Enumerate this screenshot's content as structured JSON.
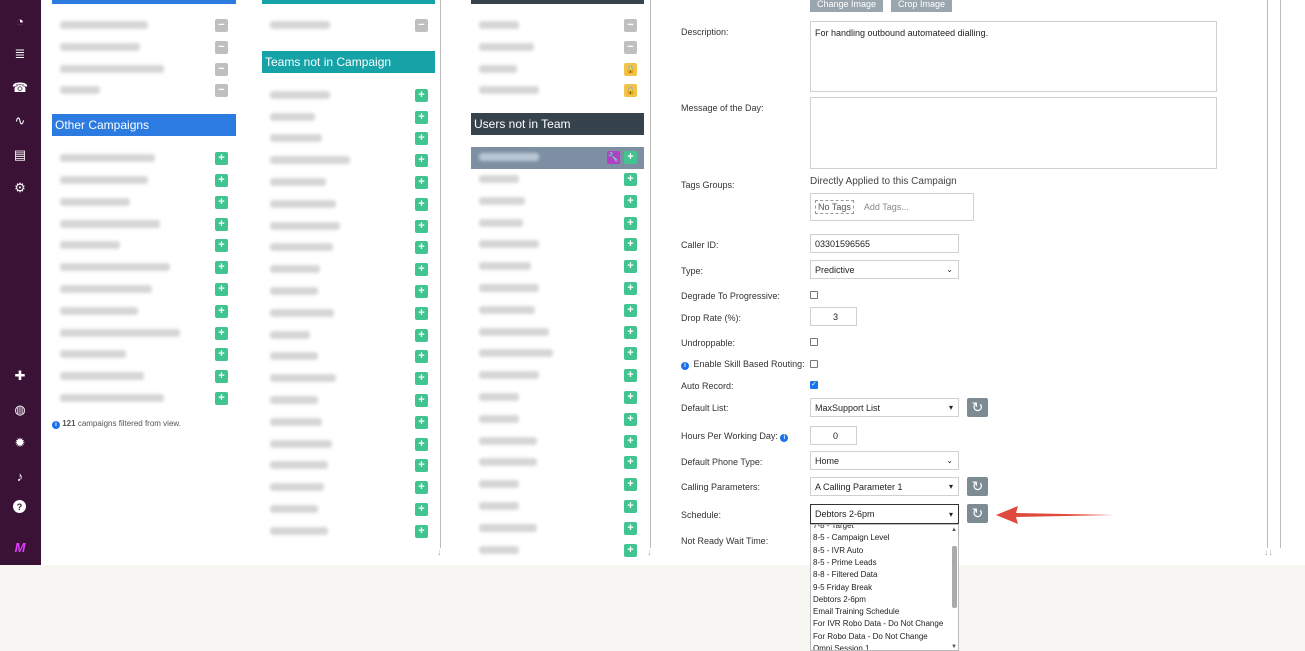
{
  "sidebar": {
    "icons": [
      "dashboard-icon",
      "database-icon",
      "phone-book-icon",
      "soundwave-icon",
      "report-icon",
      "settings-gears-icon",
      "puzzle-icon",
      "globe-icon",
      "gear-icon",
      "bell-icon",
      "help-icon",
      "logo-icon"
    ],
    "glyphs": {
      "dashboard-icon": "◔",
      "database-icon": "≣",
      "phone-book-icon": "☎",
      "soundwave-icon": "∿",
      "report-icon": "▤",
      "settings-gears-icon": "⚙",
      "puzzle-icon": "✚",
      "globe-icon": "◍",
      "gear-icon": "✹",
      "bell-icon": "♪",
      "help-icon": "?",
      "logo-icon": "M"
    }
  },
  "campaigns": {
    "other_header": "Other Campaigns",
    "footer_count": "121",
    "footer_text": " campaigns filtered from view."
  },
  "teams": {
    "not_in_campaign_header": "Teams not in Campaign"
  },
  "users": {
    "not_in_team_header": "Users not in Team"
  },
  "image_buttons": {
    "change": "Change Image",
    "crop": "Crop Image"
  },
  "form": {
    "description_label": "Description:",
    "description_value": "For handling outbound automateed dialling.",
    "motd_label": "Message of the Day:",
    "motd_value": "",
    "tags_groups_label": "Tags Groups:",
    "tags_applied_text": "Directly Applied to this Campaign",
    "no_tags": "No Tags",
    "add_tags_placeholder": "Add Tags...",
    "caller_id_label": "Caller ID:",
    "caller_id_value": "03301596565",
    "type_label": "Type:",
    "type_value": "Predictive",
    "degrade_label": "Degrade To Progressive:",
    "drop_rate_label": "Drop Rate (%):",
    "drop_rate_value": "3",
    "undroppable_label": "Undroppable:",
    "skill_routing_label": "Enable Skill Based Routing:",
    "auto_record_label": "Auto Record:",
    "default_list_label": "Default List:",
    "default_list_value": "MaxSupport List",
    "hours_label": "Hours Per Working Day:",
    "hours_value": "0",
    "phone_type_label": "Default Phone Type:",
    "phone_type_value": "Home",
    "calling_params_label": "Calling Parameters:",
    "calling_params_value": "A Calling Parameter 1",
    "schedule_label": "Schedule:",
    "schedule_value": "Debtors 2-6pm",
    "not_ready_label": "Not Ready Wait Time:",
    "degrade_checked": false,
    "undroppable_checked": false,
    "skill_routing_checked": false,
    "auto_record_checked": true
  },
  "schedule_options": [
    "7-8 - Target",
    "8-5 - Campaign Level",
    "8-5 - IVR Auto",
    "8-5 - Prime Leads",
    "8-8 - Filtered Data",
    "9-5 Friday Break",
    "Debtors 2-6pm",
    "Email Training Schedule",
    "For IVR Robo Data - Do Not Change",
    "For Robo Data - Do Not Change",
    "Omni Session 1"
  ],
  "colors": {
    "sidebar": "#3a1236",
    "blue_header": "#2c7be0",
    "teal_header": "#15a3a8",
    "dark_header": "#36434d",
    "add_green": "#42c491",
    "arrow_red": "#e04a3c"
  }
}
